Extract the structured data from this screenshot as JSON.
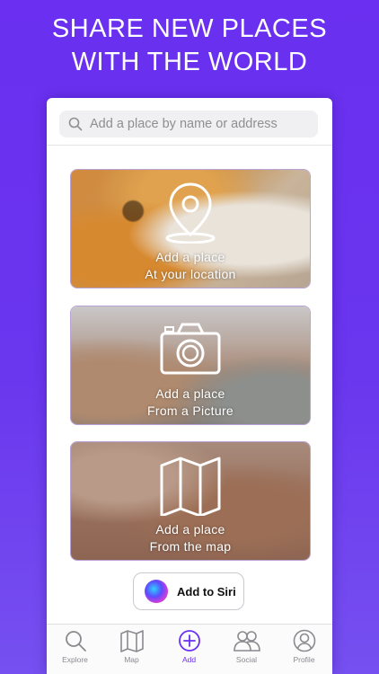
{
  "headline": {
    "line1": "SHARE NEW PLACES",
    "line2": "WITH THE WORLD"
  },
  "search": {
    "placeholder": "Add a place by name or address",
    "icon": "search-icon"
  },
  "cards": [
    {
      "title": "Add a place",
      "subtitle": "At your location",
      "icon": "location-pin-icon"
    },
    {
      "title": "Add a place",
      "subtitle": "From a Picture",
      "icon": "camera-icon"
    },
    {
      "title": "Add a place",
      "subtitle": "From the map",
      "icon": "map-icon"
    }
  ],
  "siri": {
    "label": "Add to Siri",
    "icon": "siri-icon"
  },
  "tabs": [
    {
      "label": "Explore",
      "icon": "search-icon"
    },
    {
      "label": "Map",
      "icon": "map-icon"
    },
    {
      "label": "Add",
      "icon": "add-circle-icon",
      "active": true
    },
    {
      "label": "Social",
      "icon": "people-icon"
    },
    {
      "label": "Profile",
      "icon": "person-icon"
    }
  ],
  "colors": {
    "accent": "#6a2ff0",
    "tab_inactive": "#8a8a8f",
    "background": "#6a2ff0"
  }
}
